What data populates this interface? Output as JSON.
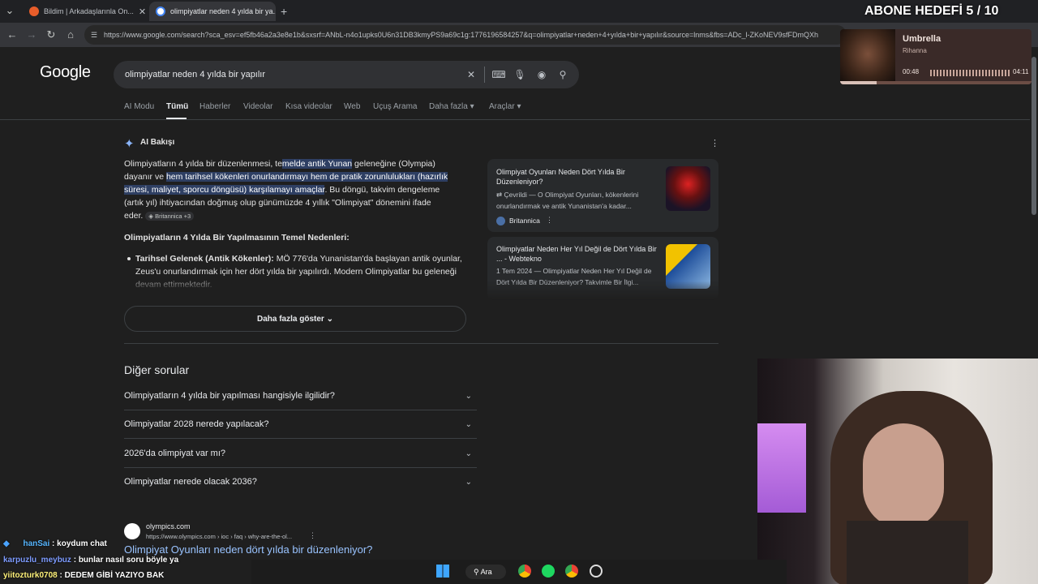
{
  "browser": {
    "tabs": [
      {
        "title": "Bildim | Arkadaşlarınla On...",
        "active": false
      },
      {
        "title": "olimpiyatlar neden 4 yılda bir ya...",
        "active": true
      }
    ],
    "new_tab": "+",
    "url": "https://www.google.com/search?sca_esv=ef5fb46a2a3e8e1b&sxsrf=ANbL-n4o1upks0U6n31DB3kmyPS9a69c1g:1776196584257&q=olimpiyatlar+neden+4+yılda+bir+yapılır&source=lnms&fbs=ADc_l-ZKoNEV9sfFDmQXh"
  },
  "overlay": {
    "goal": "ABONE HEDEFİ 5 / 10",
    "music": {
      "title": "Umbrella",
      "artist": "Rihanna",
      "elapsed": "00:48",
      "total": "04:11",
      "progress": 0.19
    }
  },
  "google": {
    "logo": "Google",
    "query": "olimpiyatlar neden 4 yılda bir yapılır",
    "tabs": [
      "AI Modu",
      "Tümü",
      "Haberler",
      "Videolar",
      "Kısa videolar",
      "Web",
      "Uçuş Arama",
      "Daha fazla",
      "Araçlar"
    ],
    "active_tab": "Tümü"
  },
  "ai": {
    "label": "AI Bakışı",
    "p1": "Olimpiyatların 4 yılda bir düzenlenmesi, te",
    "p1_hl1": "melde antik Yunan",
    "p1_b": " geleneğine (Olympia) dayanır ve ",
    "p1_hl2": "hem tarihsel kökenleri onurlandırmayı hem de pratik zorunlulukları (hazırlık süresi, maliyet, sporcu döngüsü) karşılamayı amaçlar",
    "p1_c": ". Bu döngü, takvim dengeleme (artık yıl) ihtiyacından doğmuş olup günümüzde 4 yıllık \"Olimpiyat\" dönemini ifade eder.",
    "source_chip": "Britannica +3",
    "heading": "Olimpiyatların 4 Yılda Bir Yapılmasının Temel Nedenleri:",
    "bullet_title": "Tarihsel Gelenek (Antik Kökenler):",
    "bullet_text": " MÖ 776'da Yunanistan'da başlayan antik oyunlar, Zeus'u onurlandırmak için her dört yılda bir yapılırdı. Modern Olimpiyatlar bu geleneği devam ettirmektedir.",
    "show_more": "Daha fazla göster",
    "cards": [
      {
        "title": "Olimpiyat Oyunları Neden Dört Yılda Bir Düzenleniyor?",
        "snippet": "Çevrildi — O Olimpiyat Oyunları, kökenlerini onurlandırmak ve antik Yunanistan'a kadar...",
        "source": "Britannica"
      },
      {
        "title": "Olimpiyatlar Neden Her Yıl Değil de Dört Yılda Bir ... - Webtekno",
        "snippet": "1 Tem 2024 — Olimpiyatlar Neden Her Yıl Değil de Dört Yılda Bir Düzenleniyor? Takvimle Bir İlgi...",
        "source": ""
      }
    ]
  },
  "paa": {
    "title": "Diğer sorular",
    "questions": [
      "Olimpiyatların 4 yılda bir yapılması hangisiyle ilgilidir?",
      "Olimpiyatlar 2028 nerede yapılacak?",
      "2026'da olimpiyat var mı?",
      "Olimpiyatlar nerede olacak 2036?"
    ]
  },
  "result": {
    "site": "olympics.com",
    "path": "https://www.olympics.com › ioc › faq › why-are-the-ol...",
    "title": "Olimpiyat Oyunları neden dört yılda bir düzenleniyor?"
  },
  "chat": [
    {
      "user": "hanSai",
      "msg": "koydum chat"
    },
    {
      "user": "karpuzlu_meybuz",
      "msg": "bunlar nasıl soru böyle ya"
    },
    {
      "user": "yiitozturk0708",
      "msg": "DEDEM GİBİ YAZIYO BAK"
    }
  ],
  "taskbar": {
    "search": "Ara"
  }
}
